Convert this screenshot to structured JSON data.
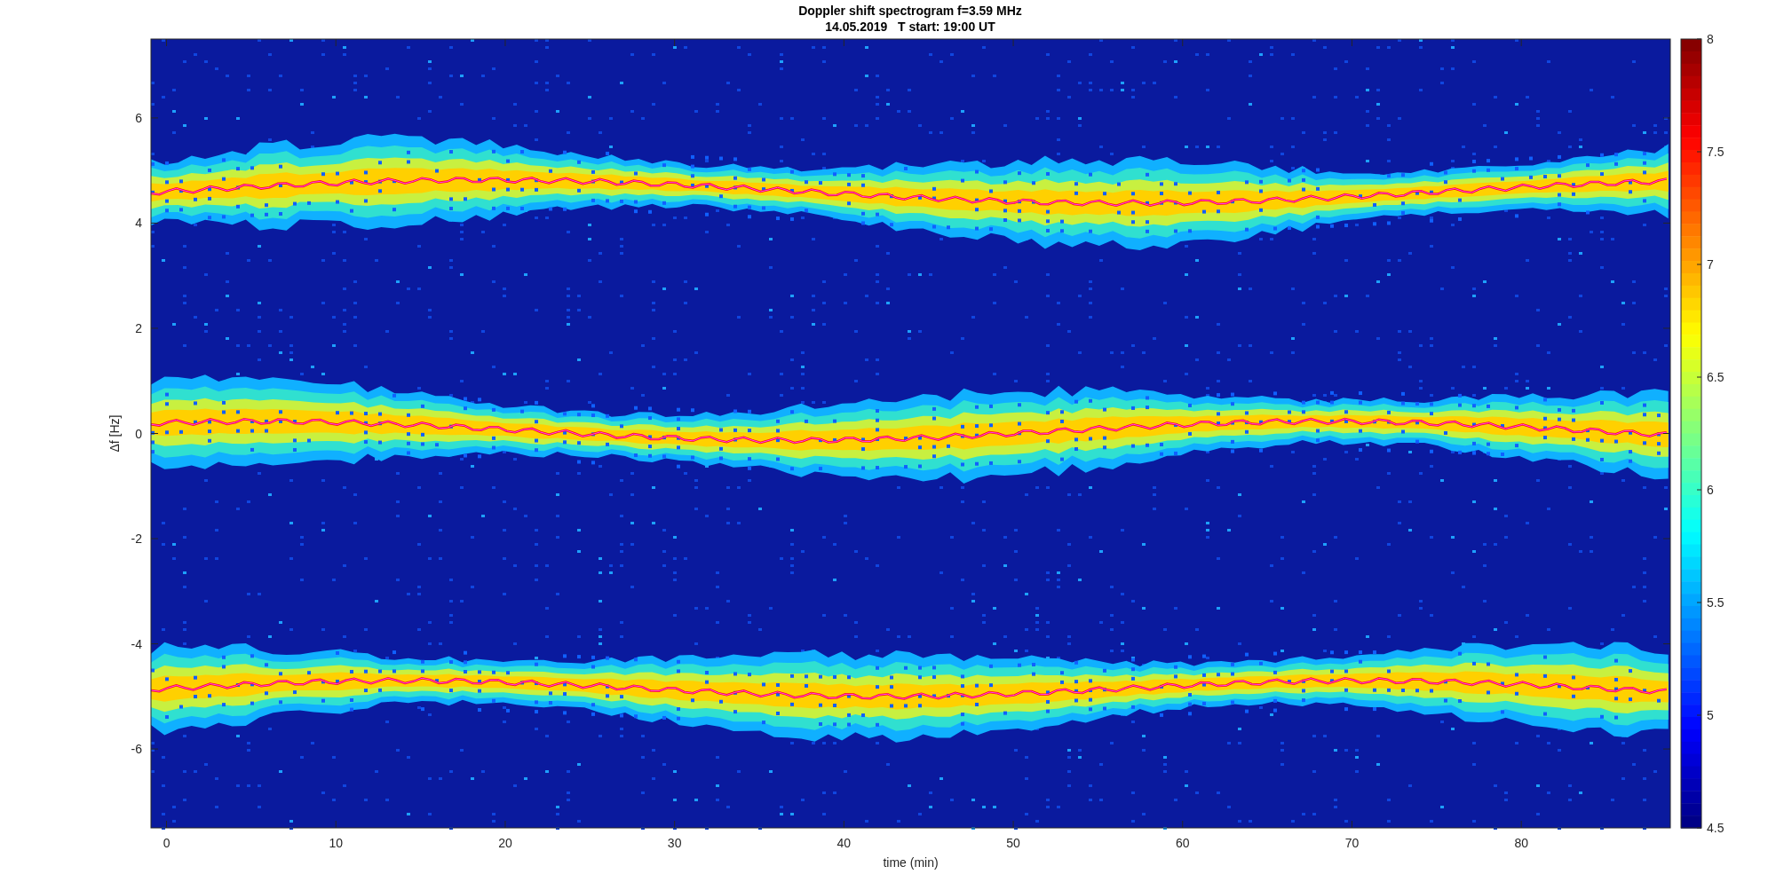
{
  "figure": {
    "title": [
      "Doppler shift spectrogram f=3.59 MHz",
      "14.05.2019   T start: 19:00 UT"
    ]
  },
  "axes": {
    "xlabel": "time (min)",
    "ylabel": "Δf [Hz]",
    "xticks": [
      "0",
      "10",
      "20",
      "30",
      "40",
      "50",
      "60",
      "70",
      "80"
    ],
    "yticks": [
      "6",
      "4",
      "2",
      "0",
      "-2",
      "-4",
      "-6"
    ]
  },
  "colorbar": {
    "ticks": [
      "8",
      "7.5",
      "7",
      "6.5",
      "6",
      "5.5",
      "5",
      "4.5"
    ]
  }
}
